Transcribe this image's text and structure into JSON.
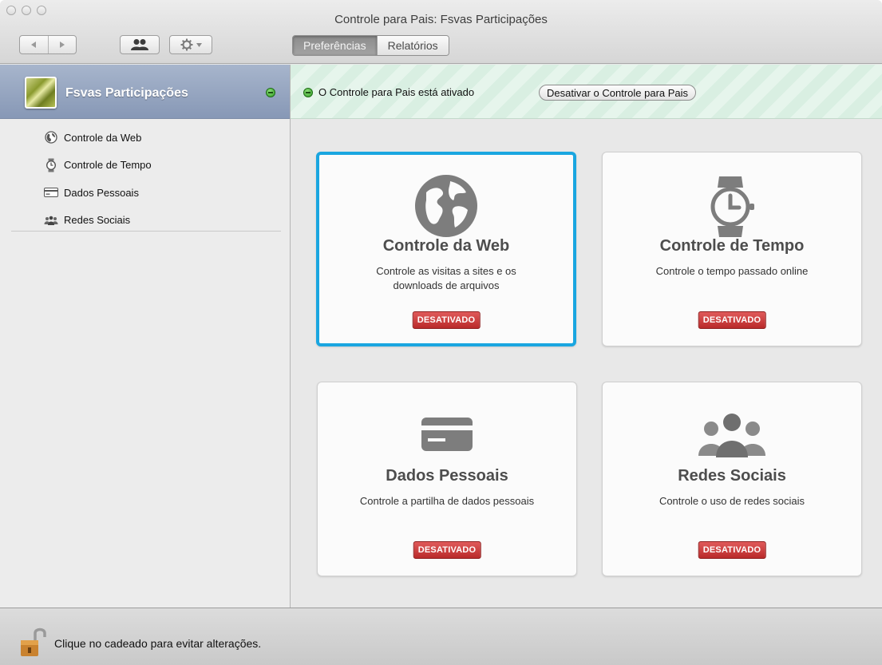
{
  "window": {
    "title": "Controle para Pais: Fsvas Participações"
  },
  "toolbar": {
    "back_icon": "triangle-left-icon",
    "forward_icon": "triangle-right-icon",
    "users_icon": "users-icon",
    "gear_icon": "gear-icon",
    "tabs": [
      {
        "label": "Preferências",
        "selected": true
      },
      {
        "label": "Relatórios",
        "selected": false
      }
    ]
  },
  "sidebar": {
    "user": {
      "name": "Fsvas Participações",
      "status": "enabled"
    },
    "items": [
      {
        "label": "Controle da Web",
        "icon": "globe-icon"
      },
      {
        "label": "Controle de Tempo",
        "icon": "watch-icon"
      },
      {
        "label": "Dados Pessoais",
        "icon": "card-icon"
      },
      {
        "label": "Redes Sociais",
        "icon": "people-icon"
      }
    ]
  },
  "banner": {
    "text": "O Controle para Pais está ativado",
    "button_label": "Desativar o Controle para Pais"
  },
  "cards": [
    {
      "title": "Controle da Web",
      "description": "Controle as visitas a sites e os downloads de arquivos",
      "status": "DESATIVADO",
      "icon": "globe-icon",
      "selected": true
    },
    {
      "title": "Controle de Tempo",
      "description": "Controle o tempo passado online",
      "status": "DESATIVADO",
      "icon": "watch-icon",
      "selected": false
    },
    {
      "title": "Dados Pessoais",
      "description": "Controle a partilha de dados pessoais",
      "status": "DESATIVADO",
      "icon": "card-icon",
      "selected": false
    },
    {
      "title": "Redes Sociais",
      "description": "Controle o uso de redes sociais",
      "status": "DESATIVADO",
      "icon": "people-icon",
      "selected": false
    }
  ],
  "footer": {
    "lock_text": "Clique no cadeado para evitar alterações.",
    "lock_icon": "padlock-open-icon"
  },
  "colors": {
    "selection": "#1aa6e0",
    "badge": "#c93535",
    "status_green": "#2f9a22",
    "sidebar_header": "#8fa0bc"
  }
}
